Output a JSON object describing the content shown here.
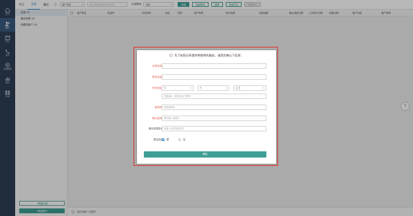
{
  "rail": {
    "items": [
      {
        "label": "首页",
        "icon": "home-icon"
      },
      {
        "label": "客户",
        "icon": "customers-icon",
        "active": true
      },
      {
        "label": "预约",
        "icon": "calendar-icon"
      },
      {
        "label": "话术",
        "icon": "phone-icon"
      },
      {
        "label": "金融数据",
        "icon": "finance-icon"
      },
      {
        "label": "报表",
        "icon": "chart-icon"
      },
      {
        "label": "商城",
        "icon": "shop-icon"
      }
    ]
  },
  "topbar": {
    "tabs": [
      "今日",
      "全部",
      "最近"
    ],
    "active_tab": "全部",
    "filter_select": "客户信息",
    "search_placeholder": "姓名/标签/地址/电话号码",
    "region_label": "区域筛选",
    "region_select": "全部",
    "buttons": {
      "search": "搜索",
      "advanced": "高级筛选",
      "reset": "重置",
      "export": "批量导出",
      "import": "批量导入"
    }
  },
  "left_panel": {
    "groups": [
      {
        "label": "全部 (0)",
        "active": true
      },
      {
        "label": "最近查看 (0)"
      },
      {
        "label": "待跟进客户 (0)"
      }
    ],
    "add_group_button": "+新建分组",
    "add_customer_button": "+新增客户"
  },
  "table": {
    "columns": [
      "客户姓名",
      "电话号",
      "手机号码",
      "地址",
      "性别",
      "客户标签",
      "积分余额",
      "充值余额",
      "最近消费日期",
      "上次拜访日期",
      "创建日期",
      "客户分组",
      "客户来源"
    ]
  },
  "bottom": {
    "prefix": "选中全部",
    "count": "0",
    "suffix": "位客户"
  },
  "help_label": "?",
  "modal": {
    "title": "为了给您分享提供更周到的服务，请您完善以下信息：",
    "fields": {
      "real_name": {
        "label": "亦称名称*",
        "placeholder": ""
      },
      "phone": {
        "label": "联系电话*",
        "placeholder": ""
      },
      "region": {
        "label": "所在地区*",
        "province": "省",
        "city": "市",
        "district": "区/县"
      },
      "address": {
        "placeholder": "详细地址（街道地址门牌号）"
      },
      "new_password": {
        "label": "新密码*",
        "placeholder": "设置新密码"
      },
      "confirm_password": {
        "label": "确认密码*",
        "placeholder": "再次输入新密码"
      },
      "business_name": {
        "label": "营业执照名称",
        "placeholder": "请输入营业执照名称"
      },
      "chain": {
        "label": "是否连锁",
        "yes": "是",
        "no": "否"
      }
    },
    "confirm_button": "确定"
  },
  "colors": {
    "accent": "#3e9e93",
    "link": "#2a8bd6",
    "required": "#e05a4f",
    "rail": "#2e3f55",
    "highlight_frame": "#e0302b"
  }
}
